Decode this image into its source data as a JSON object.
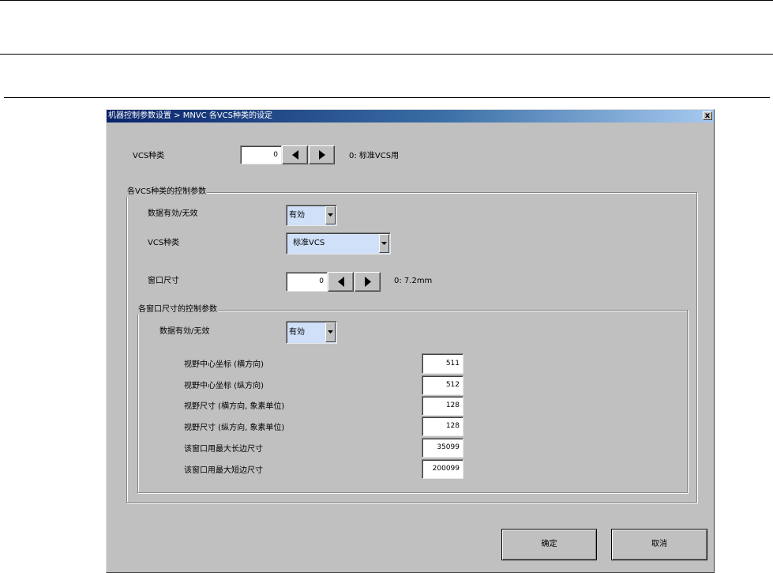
{
  "dialog": {
    "title": "机器控制参数设置 > MNVC 各VCS种类的设定",
    "close_glyph": "x"
  },
  "vcs_type": {
    "label": "VCS种类",
    "value": "0",
    "desc": "0: 标准VCS用"
  },
  "control_group": {
    "legend": "各VCS种类的控制参数",
    "data_valid_label": "数据有効/无效",
    "data_valid_value": "有効",
    "vcs_type_label": "VCS种类",
    "vcs_type_value": "标准VCS",
    "window_size_label": "窗口尺寸",
    "window_size_value": "0",
    "window_size_desc": "0:  7.2mm"
  },
  "window_group": {
    "legend": "各窗口尺寸的控制参数",
    "data_valid_label": "数据有効/无效",
    "data_valid_value": "有効",
    "rows": [
      {
        "label": "视野中心坐标 (横方向)",
        "value": "511"
      },
      {
        "label": "视野中心坐标 (纵方向)",
        "value": "512"
      },
      {
        "label": "视野尺寸 (横方向, 象素单位)",
        "value": "128"
      },
      {
        "label": "视野尺寸 (纵方向, 象素单位)",
        "value": "128"
      },
      {
        "label": "该窗口用最大长边尺寸",
        "value": "35099"
      },
      {
        "label": "该窗口用最大短边尺寸",
        "value": "200099"
      }
    ]
  },
  "buttons": {
    "ok": "确定",
    "cancel": "取消"
  }
}
